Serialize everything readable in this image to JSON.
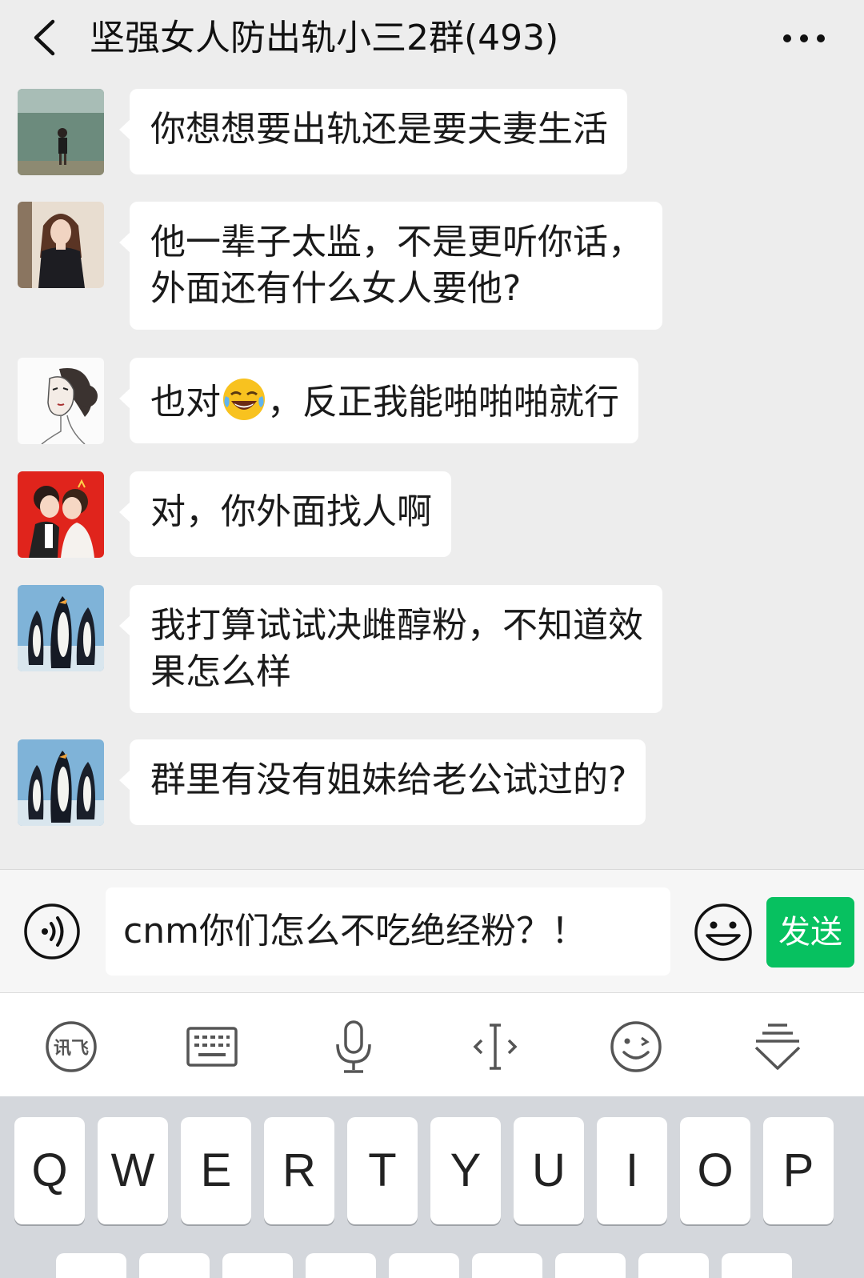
{
  "header": {
    "title": "坚强女人防出轨小三2群(493)",
    "back_icon": "chevron-left-icon",
    "more_icon": "more-dots-icon"
  },
  "messages": [
    {
      "avatar": "avatar-woman-by-sea",
      "lines": [
        "你想想要出轨还是要夫妻生活"
      ]
    },
    {
      "avatar": "avatar-woman-portrait",
      "lines": [
        "他一辈子太监，不是更听你话，",
        "外面还有什么女人要他?"
      ]
    },
    {
      "avatar": "avatar-illustrated-woman",
      "parts": [
        "也对",
        "，反正我能啪啪啪就行"
      ],
      "emoji": "tears-of-joy-emoji"
    },
    {
      "avatar": "avatar-couple-cartoon",
      "lines": [
        "对，你外面找人啊"
      ]
    },
    {
      "avatar": "avatar-penguins",
      "lines": [
        "我打算试试决雌醇粉，不知道效",
        "果怎么样"
      ]
    },
    {
      "avatar": "avatar-penguins",
      "lines": [
        "群里有没有姐妹给老公试过的?"
      ]
    }
  ],
  "input": {
    "value": "cnm你们怎么不吃绝经粉？！",
    "send_label": "发送",
    "voice_icon": "voice-icon",
    "emoji_icon": "emoji-icon"
  },
  "ime_toolbar": {
    "icons": [
      "ifly-logo-icon",
      "keyboard-icon",
      "microphone-icon",
      "cursor-move-icon",
      "wink-face-icon",
      "collapse-keyboard-icon"
    ]
  },
  "keyboard": {
    "row1": [
      "Q",
      "W",
      "E",
      "R",
      "T",
      "Y",
      "U",
      "I",
      "O",
      "P"
    ]
  },
  "colors": {
    "background": "#ededed",
    "bubble": "#ffffff",
    "send_button": "#07c160",
    "keyboard_bg": "#d4d7dc"
  }
}
